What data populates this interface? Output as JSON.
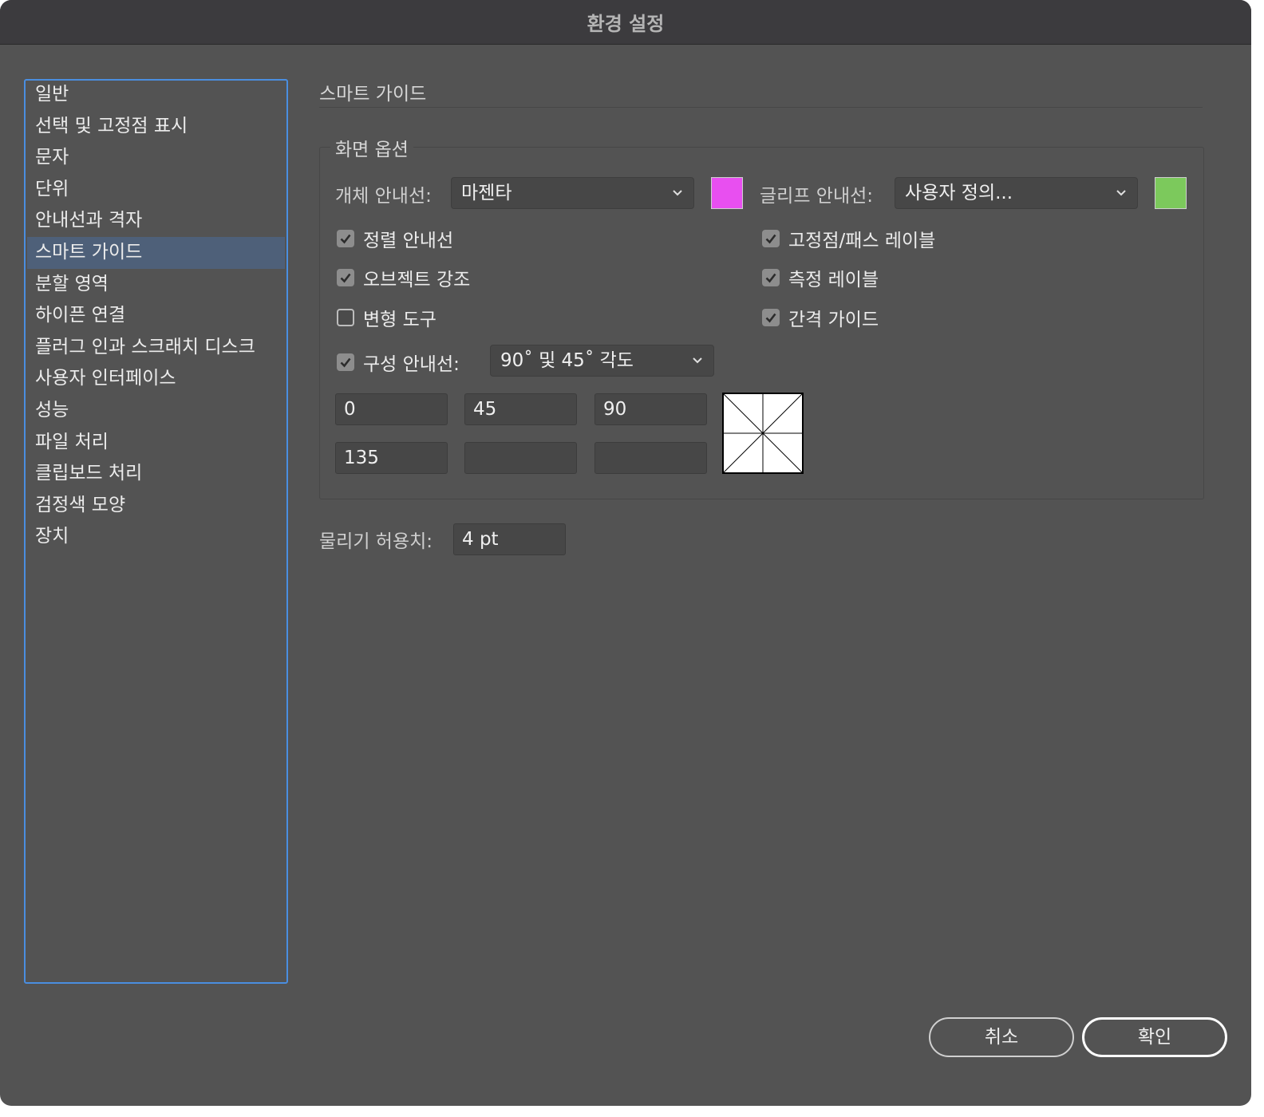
{
  "window": {
    "title": "환경 설정"
  },
  "sidebar": {
    "items": [
      {
        "label": "일반"
      },
      {
        "label": "선택 및 고정점 표시"
      },
      {
        "label": "문자"
      },
      {
        "label": "단위"
      },
      {
        "label": "안내선과 격자"
      },
      {
        "label": "스마트 가이드",
        "selected": true
      },
      {
        "label": "분할 영역"
      },
      {
        "label": "하이픈 연결"
      },
      {
        "label": "플러그 인과 스크래치 디스크"
      },
      {
        "label": "사용자 인터페이스"
      },
      {
        "label": "성능"
      },
      {
        "label": "파일 처리"
      },
      {
        "label": "클립보드 처리"
      },
      {
        "label": "검정색 모양"
      },
      {
        "label": "장치"
      }
    ]
  },
  "main": {
    "section_title": "스마트 가이드",
    "display_options": {
      "legend": "화면 옵션",
      "object_guides": {
        "label": "개체 안내선:",
        "value": "마젠타",
        "color": "#e84ff0"
      },
      "glyph_guides": {
        "label": "글리프 안내선:",
        "value": "사용자 정의...",
        "color": "#7cc95c"
      },
      "checkboxes": {
        "alignment_guides": {
          "label": "정렬 안내선",
          "checked": true
        },
        "object_highlighting": {
          "label": "오브젝트 강조",
          "checked": true
        },
        "transform_tools": {
          "label": "변형 도구",
          "checked": false
        },
        "anchor_path_labels": {
          "label": "고정점/패스 레이블",
          "checked": true
        },
        "measurement_labels": {
          "label": "측정 레이블",
          "checked": true
        },
        "spacing_guides": {
          "label": "간격 가이드",
          "checked": true
        }
      },
      "construction_guides": {
        "label": "구성 안내선:",
        "checked": true,
        "value": "90˚ 및 45˚ 각도",
        "angles": [
          "0",
          "45",
          "90",
          "135",
          "",
          ""
        ]
      }
    },
    "snapping_tolerance": {
      "label": "물리기 허용치:",
      "value": "4 pt"
    }
  },
  "buttons": {
    "cancel": "취소",
    "ok": "확인"
  }
}
